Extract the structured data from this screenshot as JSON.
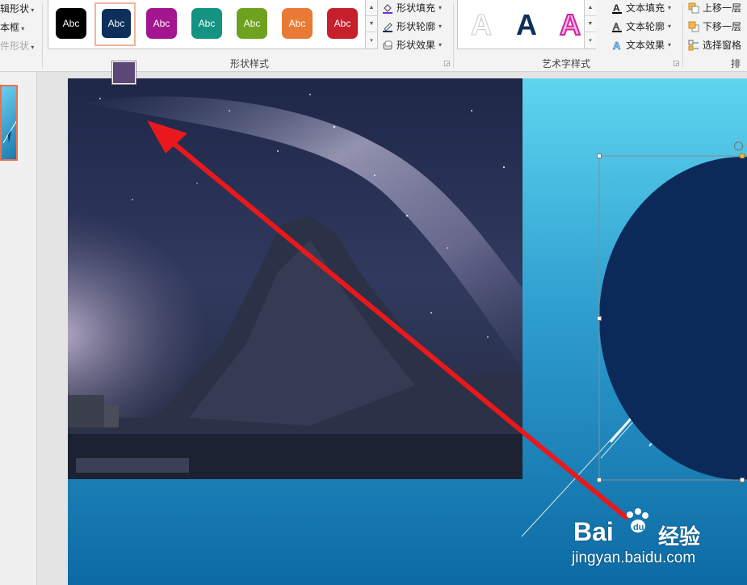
{
  "ribbon": {
    "left_group": {
      "items": [
        "辑形状",
        "本框",
        "件形状"
      ]
    },
    "shape_styles": {
      "label": "形状样式",
      "gallery_label": "Abc",
      "styles": [
        {
          "fill": "#000000",
          "text": "#ffffff"
        },
        {
          "fill": "#0e2f5a",
          "text": "#ffffff"
        },
        {
          "fill": "#a3168f",
          "text": "#ffffff"
        },
        {
          "fill": "#149282",
          "text": "#ffffff"
        },
        {
          "fill": "#6ea21e",
          "text": "#ffffff"
        },
        {
          "fill": "#e97a35",
          "text": "#ffffff"
        },
        {
          "fill": "#c6202c",
          "text": "#ffffff"
        }
      ],
      "selected_index": 1,
      "commands": {
        "fill": "形状填充",
        "outline": "形状轮廓",
        "effects": "形状效果"
      }
    },
    "wordart_styles": {
      "label": "艺术字样式",
      "letter": "A",
      "commands": {
        "fill": "文本填充",
        "outline": "文本轮廓",
        "effects": "文本效果"
      }
    },
    "arrange": {
      "label": "排",
      "commands": {
        "bring_forward": "上移一层",
        "send_backward": "下移一层",
        "selection_pane": "选择窗格"
      }
    }
  },
  "colors": {
    "accent_swatch": "#5d4777",
    "circle_fill": "#0b2a5a",
    "arrow": "#e8191c",
    "thumb_border": "#e8734f"
  },
  "watermark": {
    "brand_a": "Bai",
    "brand_b": "经验",
    "url": "jingyan.baidu.com"
  }
}
